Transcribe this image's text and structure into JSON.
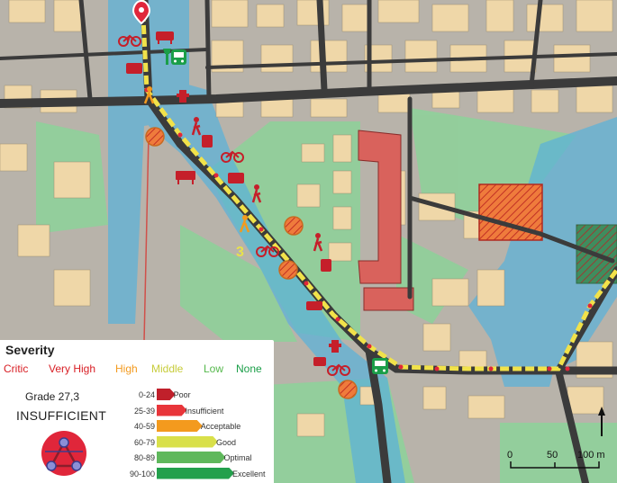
{
  "legend": {
    "title": "Severity",
    "levels": [
      {
        "label": "Critic",
        "color": "#d81e24"
      },
      {
        "label": "Very High",
        "color": "#d81e24"
      },
      {
        "label": "High",
        "color": "#f39a1e"
      },
      {
        "label": "Middle",
        "color": "#d9dc4a"
      },
      {
        "label": "Low",
        "color": "#55b84c"
      },
      {
        "label": "None",
        "color": "#1a9e48"
      }
    ],
    "grade_label": "Grade 27,3",
    "grade_status": "INSUFFICIENT"
  },
  "grade_scale": [
    {
      "range": "0-24",
      "label": "Poor",
      "color": "#c0202b",
      "level": 0.24
    },
    {
      "range": "25-39",
      "label": "Insufficient",
      "color": "#e8353a",
      "level": 0.39
    },
    {
      "range": "40-59",
      "label": "Acceptable",
      "color": "#f39a1e",
      "level": 0.59
    },
    {
      "range": "60-79",
      "label": "Good",
      "color": "#d9e04a",
      "level": 0.79
    },
    {
      "range": "80-89",
      "label": "Optimal",
      "color": "#5fb85c",
      "level": 0.89
    },
    {
      "range": "90-100",
      "label": "Excellent",
      "color": "#23a04c",
      "level": 1.0
    }
  ],
  "map": {
    "segment_label": "3",
    "scale_labels": [
      "0",
      "50",
      "100 m"
    ],
    "north_arrow": "north-arrow-icon",
    "marker_icons": [
      "pin-icon",
      "bicycle-icon",
      "bench-icon",
      "bus-icon",
      "pedestrian-icon",
      "hydrant-icon",
      "trash-bin-icon",
      "tree-icon",
      "cafe-table-icon"
    ]
  },
  "colors": {
    "route": "#f1e24a",
    "route_dots": "#e0263a",
    "buffer": "#5ab2da",
    "road": "#3b3b3b",
    "building": "#efd7a8",
    "green": "#7fc98d",
    "marker": "#c51f2a"
  }
}
